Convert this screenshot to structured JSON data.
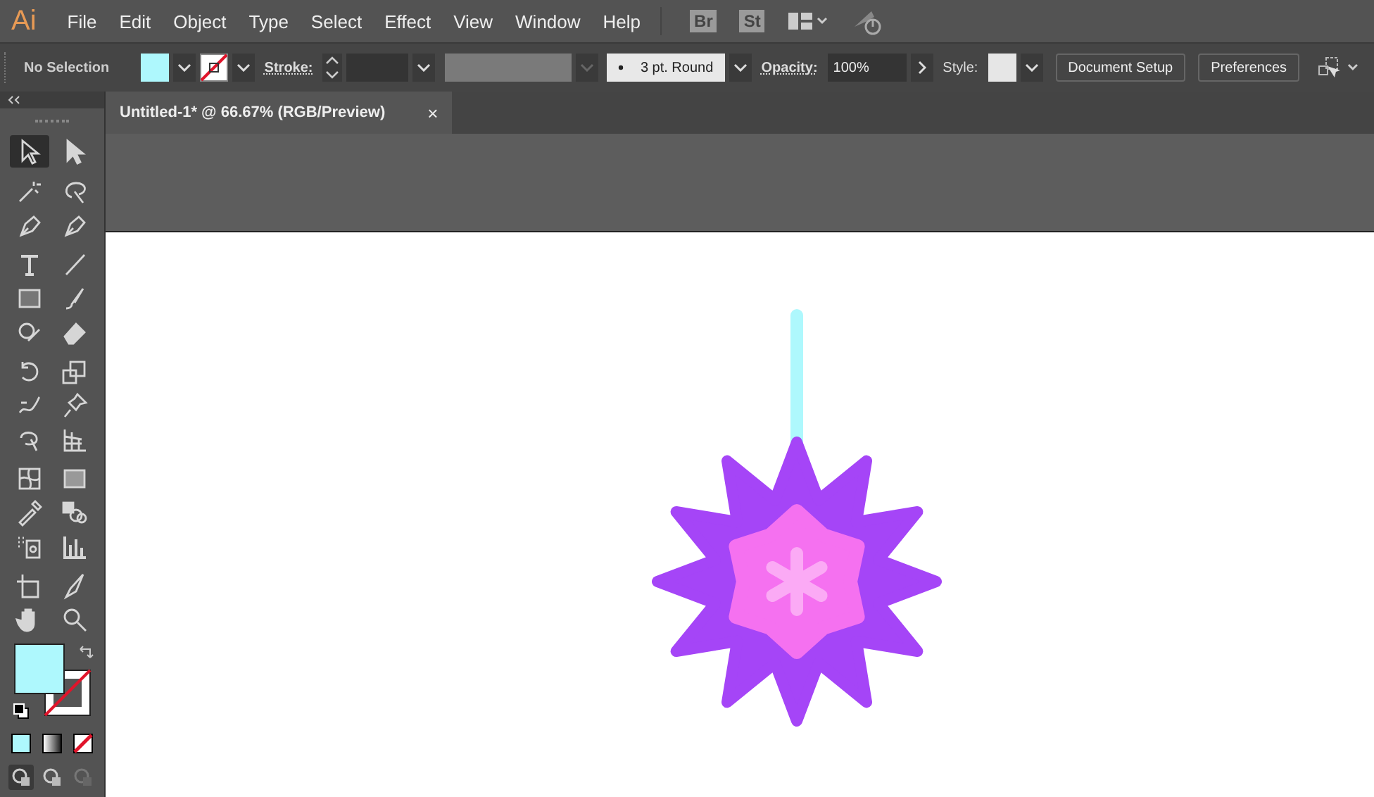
{
  "app": {
    "logo": "Ai"
  },
  "menu": [
    "File",
    "Edit",
    "Object",
    "Type",
    "Select",
    "Effect",
    "View",
    "Window",
    "Help"
  ],
  "menu_badges": [
    "Br",
    "St"
  ],
  "control_bar": {
    "selection": "No Selection",
    "stroke_label": "Stroke:",
    "brush": "3 pt. Round",
    "opacity_label": "Opacity:",
    "opacity": "100%",
    "style_label": "Style:",
    "buttons": [
      "Document Setup",
      "Preferences"
    ]
  },
  "document_tab": {
    "title": "Untitled-1* @ 66.67% (RGB/Preview)",
    "close": "×"
  },
  "tools": [
    {
      "selected": true
    },
    {
      "selected": false
    },
    {
      "selected": false
    },
    {
      "selected": false
    },
    {
      "selected": false
    },
    {
      "selected": false
    },
    {
      "selected": false
    },
    {
      "selected": false
    },
    {
      "selected": false
    },
    {
      "selected": false
    },
    {
      "selected": false
    },
    {
      "selected": false
    },
    {
      "selected": false
    },
    {
      "selected": false
    },
    {
      "selected": false
    },
    {
      "selected": false
    },
    {
      "selected": false
    },
    {
      "selected": false
    },
    {
      "selected": false
    },
    {
      "selected": false
    },
    {
      "selected": false
    },
    {
      "selected": false
    },
    {
      "selected": false
    },
    {
      "selected": false
    },
    {
      "selected": false
    },
    {
      "selected": false
    },
    {
      "selected": false
    },
    {
      "selected": false
    }
  ],
  "draw_modes": [
    {
      "selected": true
    },
    {
      "selected": false
    },
    {
      "selected": false
    }
  ]
}
